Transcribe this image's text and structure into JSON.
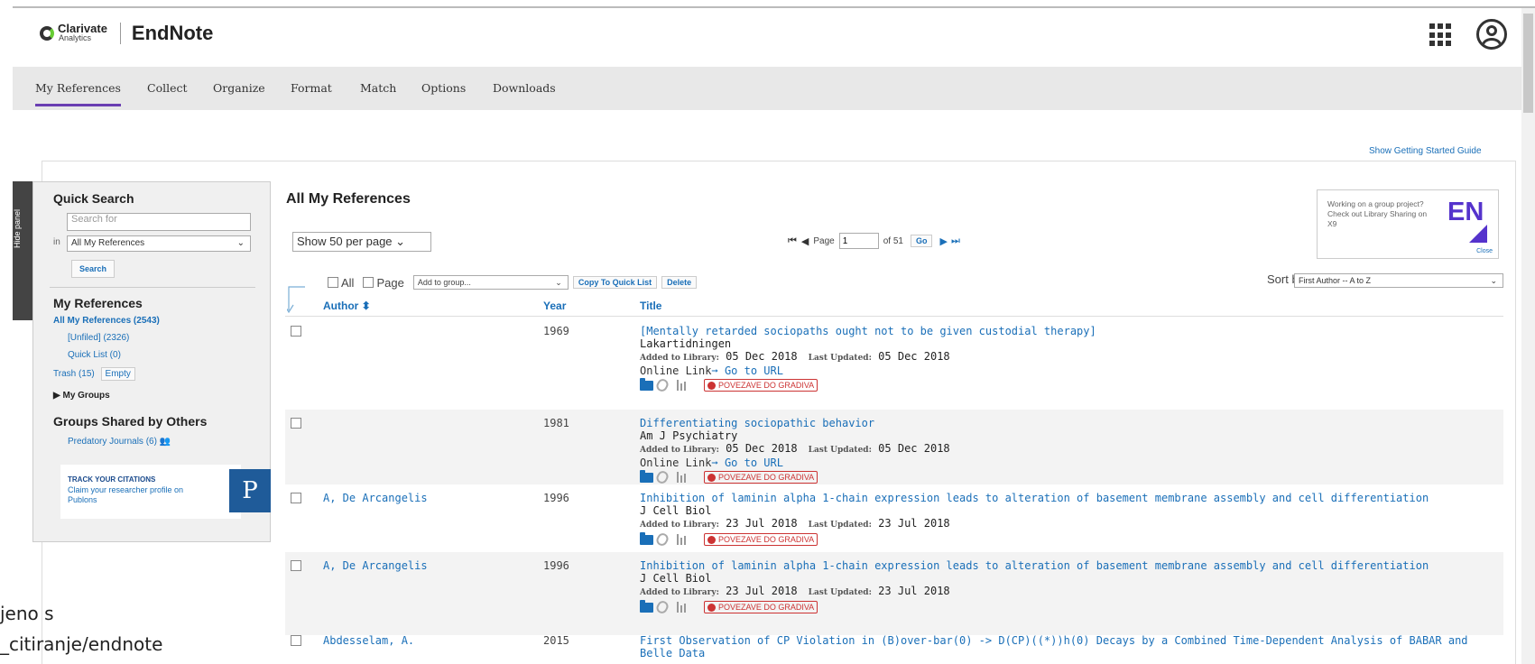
{
  "header": {
    "logo_line1": "Clarivate",
    "logo_line2": "Analytics",
    "app_name": "EndNote"
  },
  "nav": {
    "items": [
      "My References",
      "Collect",
      "Organize",
      "Format",
      "Match",
      "Options",
      "Downloads"
    ],
    "active": "My References"
  },
  "getting_started": "Show Getting Started Guide",
  "hide_panel": "Hide panel",
  "left_panel": {
    "quick_search_title": "Quick Search",
    "search_placeholder": "Search for",
    "in_label": "in",
    "in_value": "All My References",
    "search_button": "Search",
    "my_refs_title": "My References",
    "all_refs": "All My References (2543)",
    "unfiled": "[Unfiled] (2326)",
    "quick_list": "Quick List (0)",
    "trash": "Trash (15)",
    "empty": "Empty",
    "my_groups": "My Groups",
    "shared_title": "Groups Shared by Others",
    "predatory": "Predatory Journals (6)",
    "publons_title": "TRACK YOUR CITATIONS",
    "publons_text": "Claim your researcher profile on Publons",
    "publons_logo": "P"
  },
  "main": {
    "title": "All My References",
    "per_page": "Show 50 per page",
    "page_label": "Page",
    "page_value": "1",
    "of_pages": "of 51",
    "go": "Go",
    "all_label": "All",
    "page_cb_label": "Page",
    "add_group": "Add to group...",
    "copy_quick": "Copy To Quick List",
    "delete": "Delete",
    "sort_label": "Sort by:",
    "sort_value": "First Author -- A to Z"
  },
  "promo": {
    "text": "Working on a group project? Check out Library Sharing on X9",
    "logo": "EN",
    "close": "Close"
  },
  "columns": {
    "author": "Author",
    "year": "Year",
    "title": "Title"
  },
  "labels": {
    "added": "Added to Library:",
    "updated": "Last Updated:",
    "online_link": "Online Link",
    "go_to_url": "Go to URL",
    "gradiva": "POVEZAVE DO GRADIVA"
  },
  "rows": [
    {
      "author": "",
      "year": "1969",
      "title": "[Mentally retarded sociopaths ought not to be given custodial therapy]",
      "journal": "Lakartidningen",
      "added": "05 Dec 2018",
      "updated": "05 Dec 2018",
      "online": true
    },
    {
      "author": "",
      "year": "1981",
      "title": "Differentiating sociopathic behavior",
      "journal": "Am J Psychiatry",
      "added": "05 Dec 2018",
      "updated": "05 Dec 2018",
      "online": true
    },
    {
      "author": "A, De Arcangelis",
      "year": "1996",
      "title": "Inhibition of laminin alpha 1-chain expression leads to alteration of basement membrane assembly and cell differentiation",
      "journal": "J Cell Biol",
      "added": "23 Jul 2018",
      "updated": "23 Jul 2018",
      "online": false
    },
    {
      "author": "A, De Arcangelis",
      "year": "1996",
      "title": "Inhibition of laminin alpha 1-chain expression leads to alteration of basement membrane assembly and cell differentiation",
      "journal": "J Cell Biol",
      "added": "23 Jul 2018",
      "updated": "23 Jul 2018",
      "online": false
    },
    {
      "author": "Abdesselam, A.",
      "year": "2015",
      "title": "First Observation of CP Violation in (B)over-bar(0) -> D(CP)((*))h(0) Decays by a Combined Time-Dependent Analysis of BABAR and",
      "journal": "Belle Data",
      "added": "",
      "updated": "",
      "online": false
    }
  ],
  "watermark": {
    "line1": "jeno s",
    "line2": "_citiranje/endnote"
  }
}
